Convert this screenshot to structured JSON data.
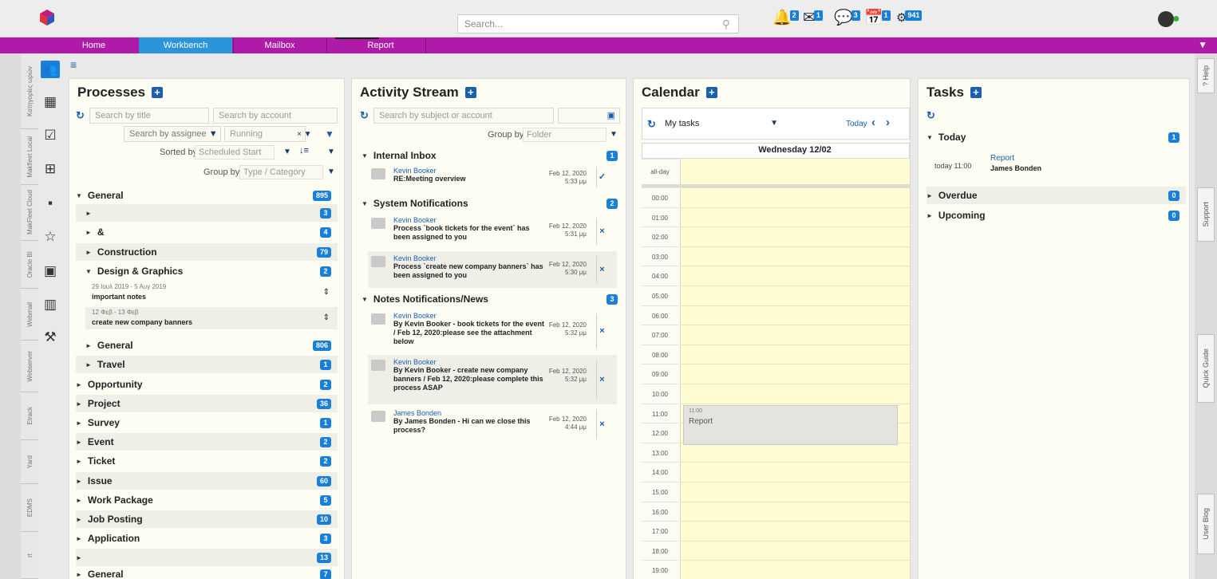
{
  "topbar": {
    "search_placeholder": "Search...",
    "badges": {
      "alerts": "2",
      "mail": "1",
      "chat": "3",
      "calendar": "1",
      "settings": "941"
    }
  },
  "nav": {
    "items": [
      "Home",
      "Workbench",
      "Mailbox",
      "",
      "Report"
    ]
  },
  "left_tabs": [
    "Κατηγορίες ωρών",
    "Makfleet Local",
    "MakFleet Cloud",
    "Oracle BI",
    "Webmail",
    "Webserver",
    "Etrack",
    "Yard",
    "EDMS",
    "rt"
  ],
  "right_tabs": [
    "? Help",
    "Support",
    "Quick Guide",
    "User Blog"
  ],
  "processes": {
    "title": "Processes",
    "search_title": "Search by title",
    "search_account": "Search by account",
    "search_assignee": "Search by assignee",
    "status": "Running",
    "sorted_by_label": "Sorted by",
    "sorted_by_value": "Scheduled Start",
    "group_by_label": "Group by",
    "group_by_value": "Type / Category",
    "rows": [
      {
        "label": "General",
        "count": "895"
      },
      {
        "label": "",
        "count": "3"
      },
      {
        "label": "&",
        "count": "4"
      },
      {
        "label": "Construction",
        "count": "79"
      },
      {
        "label": "Design & Graphics",
        "count": "2"
      },
      {
        "label": "General",
        "count": "806"
      },
      {
        "label": "Travel",
        "count": "1"
      },
      {
        "label": "Opportunity",
        "count": "2"
      },
      {
        "label": "Project",
        "count": "36"
      },
      {
        "label": "Survey",
        "count": "1"
      },
      {
        "label": "Event",
        "count": "2"
      },
      {
        "label": "Ticket",
        "count": "2"
      },
      {
        "label": "Issue",
        "count": "60"
      },
      {
        "label": "Work Package",
        "count": "5"
      },
      {
        "label": "Job Posting",
        "count": "10"
      },
      {
        "label": "Application",
        "count": "3"
      },
      {
        "label": "",
        "count": "13"
      },
      {
        "label": "General",
        "count": "7"
      }
    ],
    "subitems": [
      {
        "date": "29 Ιουλ 2019 - 5 Αυγ 2019",
        "name": "important notes"
      },
      {
        "date": "12 Φεβ - 13 Φεβ",
        "name": "create new company banners"
      }
    ]
  },
  "activity": {
    "title": "Activity Stream",
    "search": "Search by subject or account",
    "group_by_label": "Group by",
    "group_by_value": "Folder",
    "groups": [
      {
        "label": "Internal Inbox",
        "count": "1"
      },
      {
        "label": "System Notifications",
        "count": "2"
      },
      {
        "label": "Notes Notifications/News",
        "count": "3"
      }
    ],
    "messages": [
      {
        "from": "Kevin Booker",
        "text": "RE:Meeting overview",
        "date": "Feb 12, 2020",
        "time": "5:33 μμ",
        "action": "✓"
      },
      {
        "from": "Kevin Booker",
        "text": "Process `book tickets for the event` has been assigned to you",
        "date": "Feb 12, 2020",
        "time": "5:31 μμ",
        "action": "×"
      },
      {
        "from": "Kevin Booker",
        "text": "Process `create new company banners` has been assigned to you",
        "date": "Feb 12, 2020",
        "time": "5:30 μμ",
        "action": "×"
      },
      {
        "from": "Kevin Booker",
        "text": "By Kevin Booker - book tickets for the event / Feb 12, 2020:please see the attachment below",
        "date": "Feb 12, 2020",
        "time": "5:32 μμ",
        "action": "×"
      },
      {
        "from": "Kevin Booker",
        "text": "By Kevin Booker - create new company banners / Feb 12, 2020:please complete this process ASAP",
        "date": "Feb 12, 2020",
        "time": "5:32 μμ",
        "action": "×"
      },
      {
        "from": "James Bonden",
        "text": "By James Bonden - Hi can we close this process?",
        "date": "Feb 12, 2020",
        "time": "4:44 μμ",
        "action": "×"
      }
    ]
  },
  "calendar": {
    "title": "Calendar",
    "view": "My tasks",
    "today": "Today",
    "day_header": "Wednesday 12/02",
    "all_day": "all-day",
    "hours": [
      "00:00",
      "01:00",
      "02:00",
      "03:00",
      "04:00",
      "05:00",
      "06:00",
      "07:00",
      "08:00",
      "09:00",
      "10:00",
      "11:00",
      "12:00",
      "13:00",
      "14:00",
      "15:00",
      "16:00",
      "17:00",
      "18:00",
      "19:00"
    ],
    "event": {
      "time": "11:00",
      "title": "Report"
    }
  },
  "tasks": {
    "title": "Tasks",
    "today": {
      "label": "Today",
      "count": "1"
    },
    "item": {
      "time": "today 11:00",
      "title": "Report",
      "person": "James Bonden"
    },
    "overdue": {
      "label": "Overdue",
      "count": "0"
    },
    "upcoming": {
      "label": "Upcoming",
      "count": "0"
    }
  }
}
